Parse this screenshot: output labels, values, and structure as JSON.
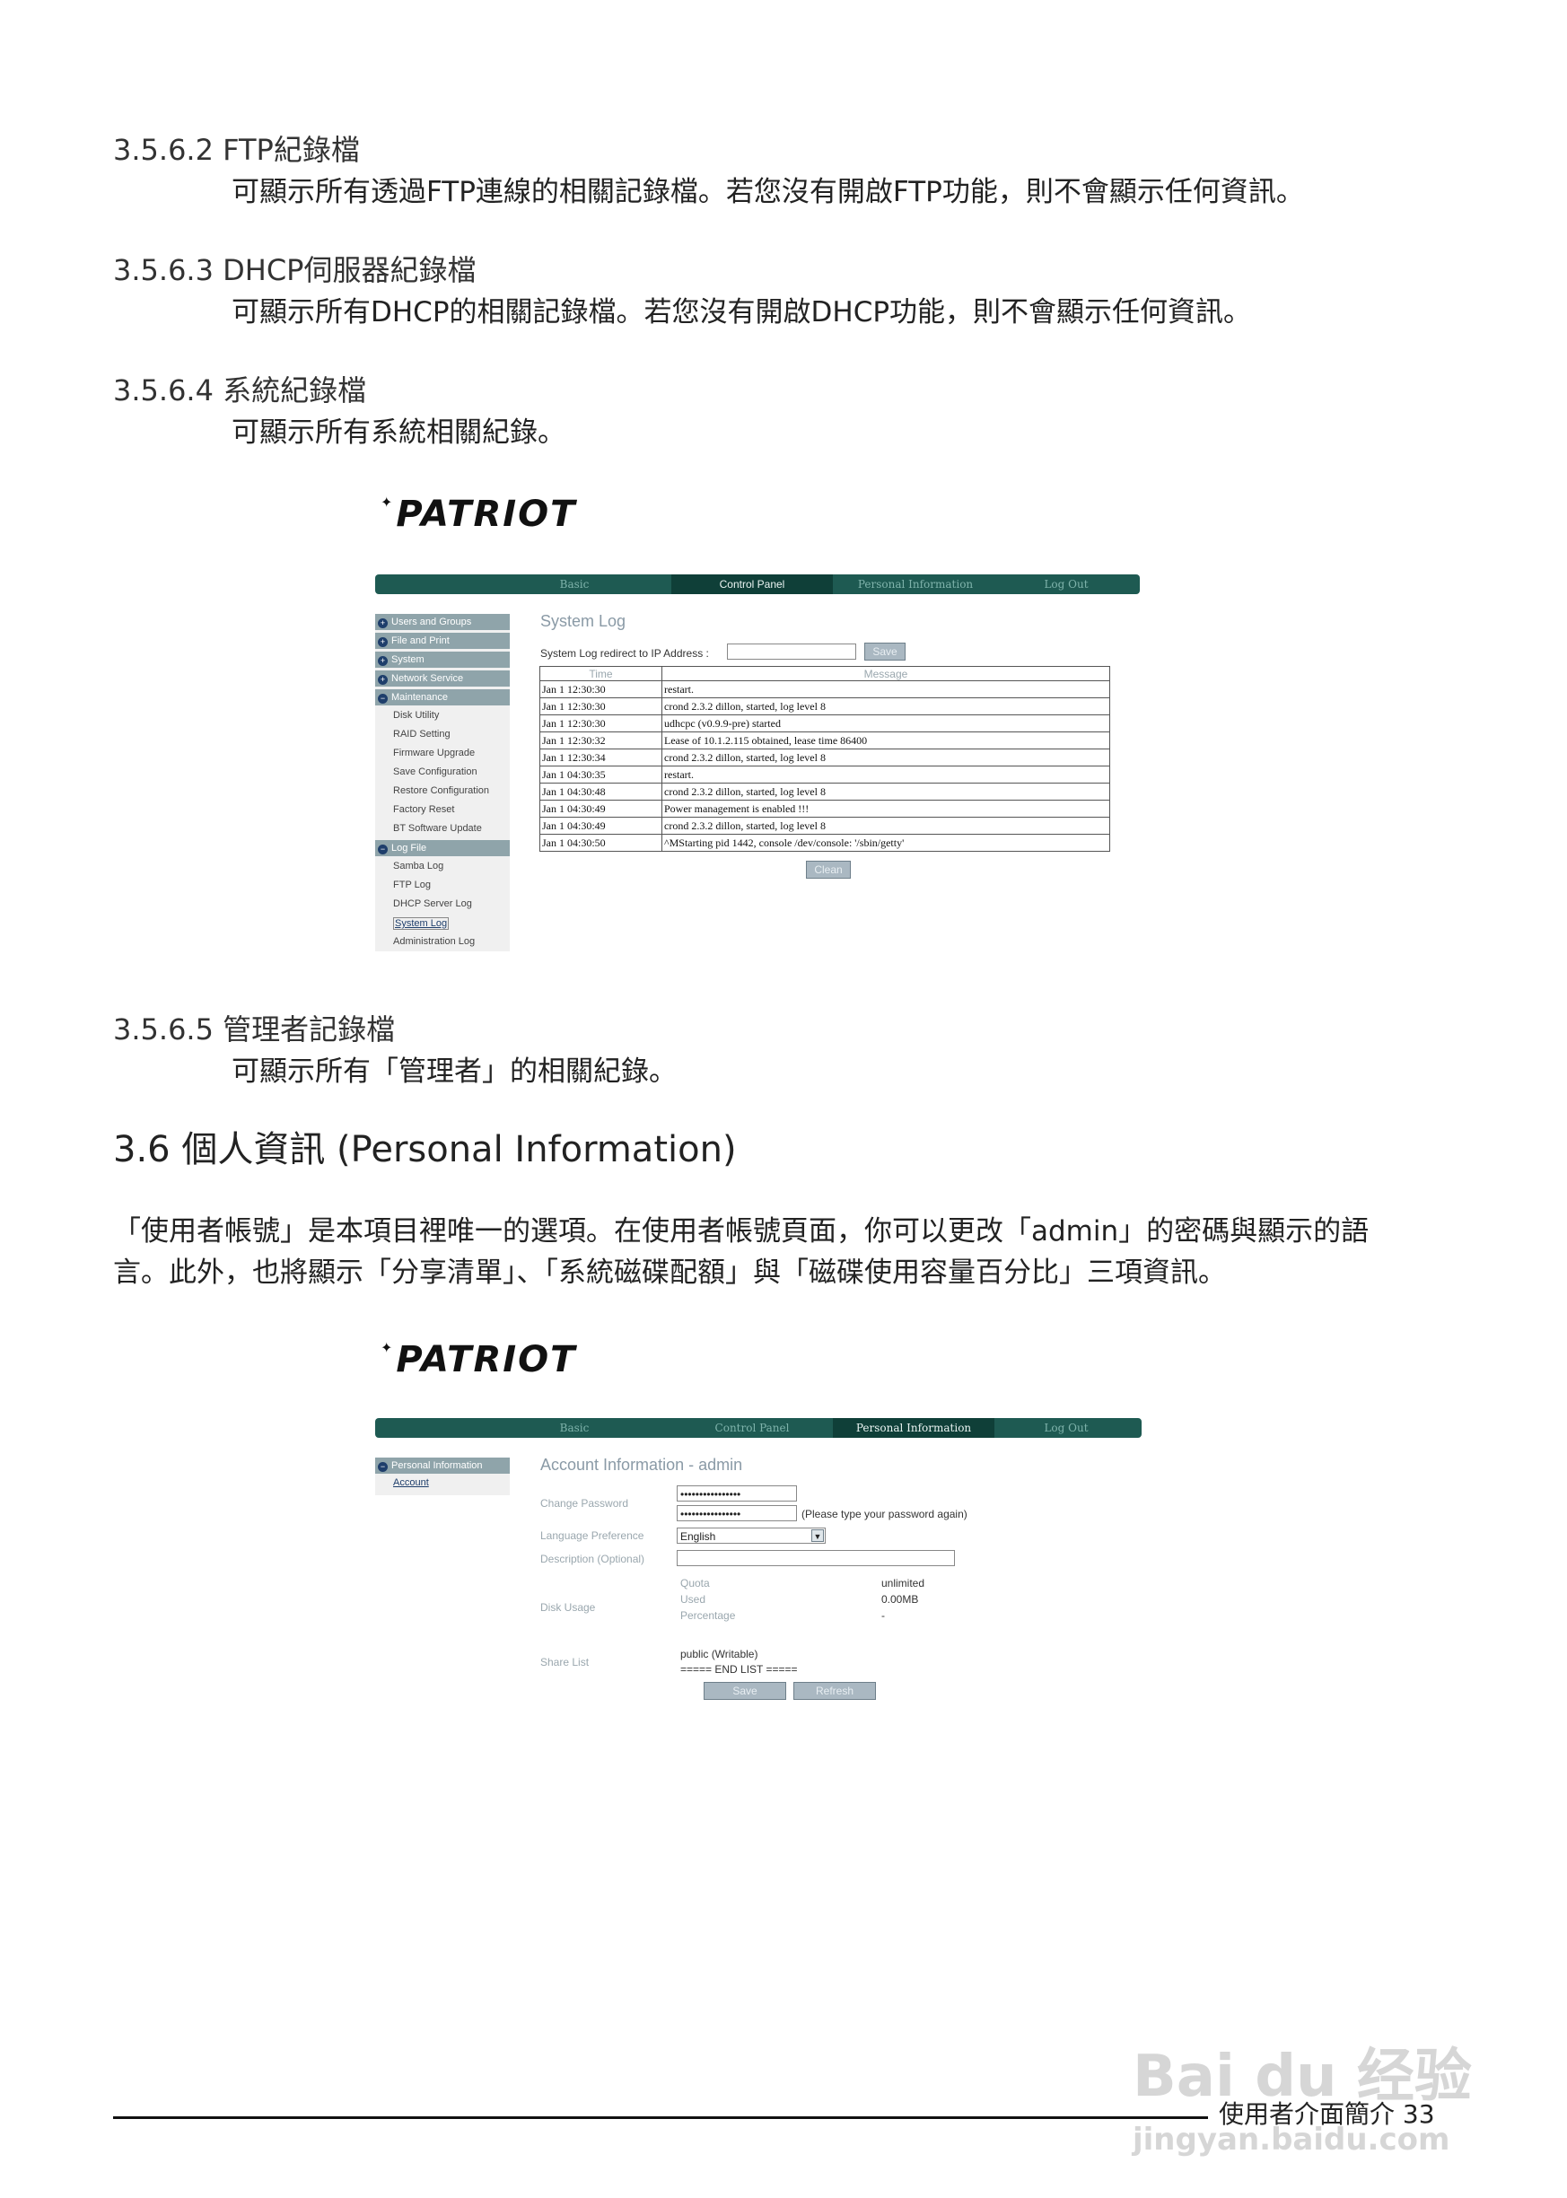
{
  "sections": {
    "s1": {
      "heading": "3.5.6.2 FTP紀錄檔",
      "body": "可顯示所有透過FTP連線的相關記錄檔。若您沒有開啟FTP功能，則不會顯示任何資訊。"
    },
    "s2": {
      "heading": "3.5.6.3 DHCP伺服器紀錄檔",
      "body": "可顯示所有DHCP的相關記錄檔。若您沒有開啟DHCP功能，則不會顯示任何資訊。"
    },
    "s3": {
      "heading": "3.5.6.4 系統紀錄檔",
      "body": "可顯示所有系統相關紀錄。"
    },
    "s4": {
      "heading": "3.5.6.5 管理者記錄檔",
      "body": "可顯示所有「管理者」的相關紀錄。"
    },
    "s5": {
      "heading": "3.6 個人資訊 (Personal Information)",
      "body_line1": "「使用者帳號」是本項目裡唯一的選項。在使用者帳號頁面，你可以更改「admin」的密碼與顯示的語",
      "body_line2": "言。此外，也將顯示「分享清單」、「系統磁碟配額」與「磁碟使用容量百分比」三項資訊。"
    }
  },
  "logo": {
    "text": "PATRIOT"
  },
  "nav": {
    "basic": "Basic",
    "control": "Control Panel",
    "personal": "Personal Information",
    "logout": "Log Out"
  },
  "screen1": {
    "sidebar": {
      "users": "Users and Groups",
      "file": "File and Print",
      "system": "System",
      "network": "Network Service",
      "maintenance": "Maintenance",
      "disk_utility": "Disk Utility",
      "raid": "RAID Setting",
      "firmware": "Firmware Upgrade",
      "save_config": "Save Configuration",
      "restore_config": "Restore Configuration",
      "factory": "Factory Reset",
      "bt": "BT Software Update",
      "logfile": "Log File",
      "samba": "Samba Log",
      "ftp": "FTP Log",
      "dhcp": "DHCP Server Log",
      "systemlog": "System Log",
      "admin": "Administration Log"
    },
    "title": "System Log",
    "redirect_label": "System Log redirect to IP Address :",
    "save_label": "Save",
    "clean_label": "Clean",
    "col_time": "Time",
    "col_message": "Message",
    "rows": [
      {
        "time": "Jan 1 12:30:30",
        "message": "restart."
      },
      {
        "time": "Jan 1 12:30:30",
        "message": "crond 2.3.2 dillon, started, log level 8"
      },
      {
        "time": "Jan 1 12:30:30",
        "message": "udhcpc (v0.9.9-pre) started"
      },
      {
        "time": "Jan 1 12:30:32",
        "message": "Lease of 10.1.2.115 obtained, lease time 86400"
      },
      {
        "time": "Jan 1 12:30:34",
        "message": "crond 2.3.2 dillon, started, log level 8"
      },
      {
        "time": "Jan 1 04:30:35",
        "message": "restart."
      },
      {
        "time": "Jan 1 04:30:48",
        "message": "crond 2.3.2 dillon, started, log level 8"
      },
      {
        "time": "Jan 1 04:30:49",
        "message": "Power management is enabled !!!"
      },
      {
        "time": "Jan 1 04:30:49",
        "message": "crond 2.3.2 dillon, started, log level 8"
      },
      {
        "time": "Jan 1 04:30:50",
        "message": "^MStarting pid 1442, console /dev/console: '/sbin/getty'"
      }
    ]
  },
  "screen2": {
    "sidebar": {
      "personal": "Personal Information",
      "account": "Account"
    },
    "title": "Account Information - admin",
    "change_password": "Change Password",
    "password_value": "••••••••••••••••",
    "retype_hint": "(Please type your password again)",
    "language_label": "Language Preference",
    "language_value": "English",
    "description_label": "Description (Optional)",
    "disk_usage_label": "Disk Usage",
    "quota_label": "Quota",
    "quota_value": "unlimited",
    "used_label": "Used",
    "used_value": "0.00MB",
    "percentage_label": "Percentage",
    "percentage_value": "-",
    "share_list_label": "Share List",
    "share_item": "public (Writable)",
    "share_end": "===== END LIST =====",
    "save_label": "Save",
    "refresh_label": "Refresh"
  },
  "footer": {
    "text": "使用者介面簡介 33"
  },
  "watermark": {
    "brand": "Bai du 经验",
    "url": "jingyan.baidu.com"
  }
}
